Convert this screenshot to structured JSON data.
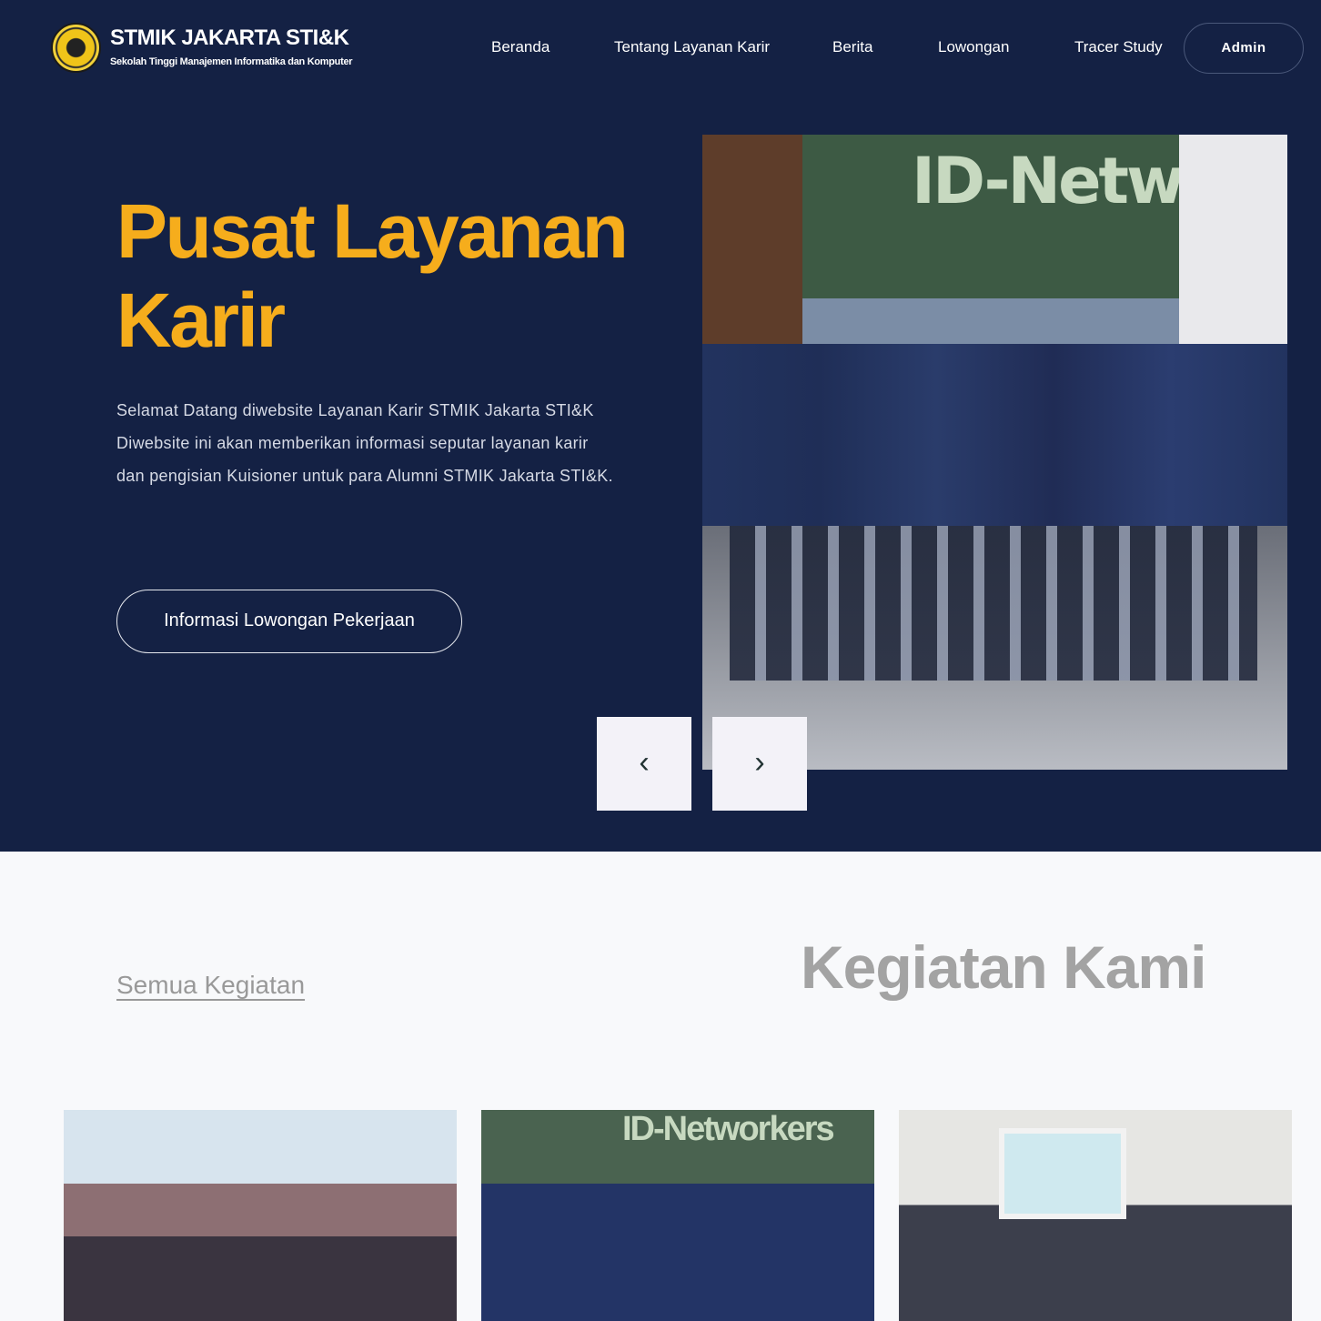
{
  "header": {
    "brand_title": "STMIK JAKARTA STI&K",
    "brand_subtitle": "Sekolah Tinggi Manajemen Informatika dan Komputer",
    "nav": [
      "Beranda",
      "Tentang Layanan Karir",
      "Berita",
      "Lowongan",
      "Tracer Study"
    ],
    "admin_label": "Admin"
  },
  "hero": {
    "title_line1": "Pusat Layanan",
    "title_line2": "Karir",
    "desc_line1": "Selamat Datang diwebsite Layanan Karir STMIK Jakarta STI&K",
    "desc_line2": "Diwebsite ini akan memberikan informasi seputar layanan karir",
    "desc_line3": "dan pengisian Kuisioner untuk para Alumni STMIK Jakarta STI&K.",
    "cta_label": "Informasi Lowongan Pekerjaan",
    "photo_banner_text": "ID-Networkers",
    "prev_icon": "‹",
    "next_icon": "›"
  },
  "activities": {
    "link_label": "Semua Kegiatan",
    "title": "Kegiatan Kami",
    "card2_banner_text": "ID-Networkers"
  },
  "colors": {
    "navy": "#142144",
    "accent": "#f6ad1c"
  }
}
